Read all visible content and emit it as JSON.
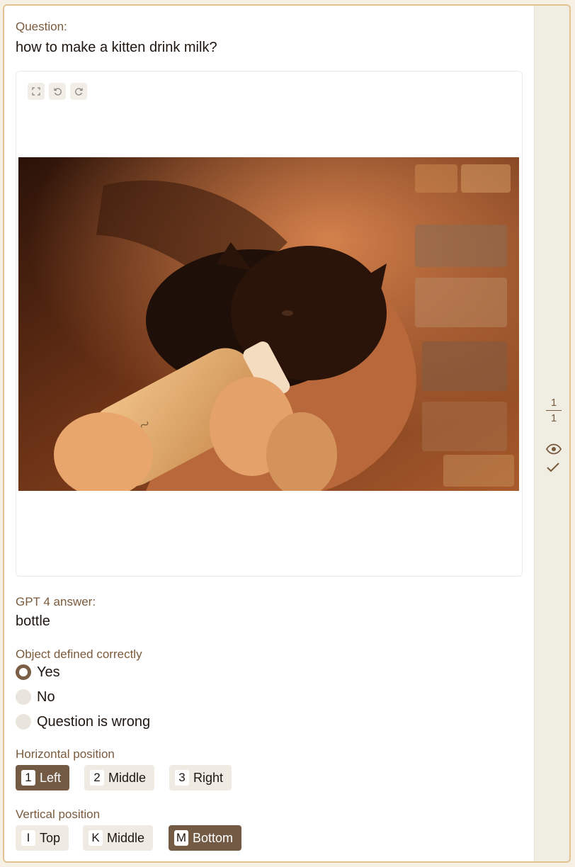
{
  "question": {
    "label": "Question:",
    "text": "how to make a kitten drink milk?"
  },
  "image_tools": {
    "icons": [
      "fullscreen-icon",
      "rotate-left-icon",
      "rotate-right-icon"
    ]
  },
  "answer": {
    "label": "GPT 4 answer:",
    "text": "bottle"
  },
  "object_defined": {
    "label": "Object defined correctly",
    "options": [
      {
        "label": "Yes",
        "checked": true
      },
      {
        "label": "No",
        "checked": false
      },
      {
        "label": "Question is wrong",
        "checked": false
      }
    ]
  },
  "horizontal": {
    "label": "Horizontal position",
    "options": [
      {
        "key": "1",
        "label": "Left",
        "active": true
      },
      {
        "key": "2",
        "label": "Middle",
        "active": false
      },
      {
        "key": "3",
        "label": "Right",
        "active": false
      }
    ]
  },
  "vertical": {
    "label": "Vertical position",
    "options": [
      {
        "key": "I",
        "label": "Top",
        "active": false
      },
      {
        "key": "K",
        "label": "Middle",
        "active": false
      },
      {
        "key": "M",
        "label": "Bottom",
        "active": true
      }
    ]
  },
  "pager": {
    "current": "1",
    "total": "1"
  },
  "colors": {
    "accent": "#725a45",
    "label": "#7a5a3c",
    "frame_border": "#e2c291",
    "rail_bg": "#f0ede3"
  }
}
